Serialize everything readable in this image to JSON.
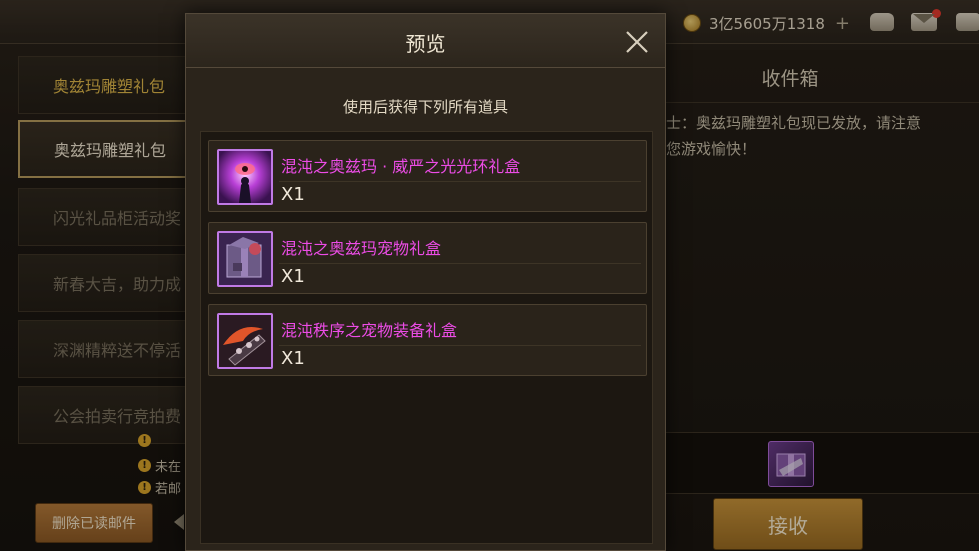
{
  "topbar": {
    "currency_amount": "3亿5605万1318",
    "currency_plus": "+",
    "icons": [
      "coin-icon",
      "bag-icon",
      "mail-icon",
      "chat-icon"
    ]
  },
  "mail_list": {
    "items": [
      {
        "label": "奥兹玛雕塑礼包"
      },
      {
        "label": "奥兹玛雕塑礼包"
      },
      {
        "label": "闪光礼品柜活动奖"
      },
      {
        "label": "新春大吉，助力成"
      },
      {
        "label": "深渊精粹送不停活"
      },
      {
        "label": "公会拍卖行竞拍费"
      }
    ],
    "notes": [
      "未在",
      "若邮"
    ],
    "delete_label": "删除已读邮件"
  },
  "inbox": {
    "title": "收件箱",
    "body_line1": "勇士：奥兹玛雕塑礼包现已发放，请注意",
    "body_line2": "祝您游戏愉快！",
    "receive_label": "接收"
  },
  "modal": {
    "title": "预览",
    "subtitle": "使用后获得下列所有道具",
    "items": [
      {
        "name": "混沌之奥兹玛 · 威严之光光环礼盒",
        "qty": "X1",
        "icon": "aura-box-icon"
      },
      {
        "name": "混沌之奥兹玛宠物礼盒",
        "qty": "X1",
        "icon": "pet-box-icon"
      },
      {
        "name": "混沌秩序之宠物装备礼盒",
        "qty": "X1",
        "icon": "pet-equipment-box-icon"
      }
    ]
  },
  "colors": {
    "item_name": "#ec4ce6",
    "accent_gold": "#c8933a",
    "active_border": "#b89b5e"
  }
}
